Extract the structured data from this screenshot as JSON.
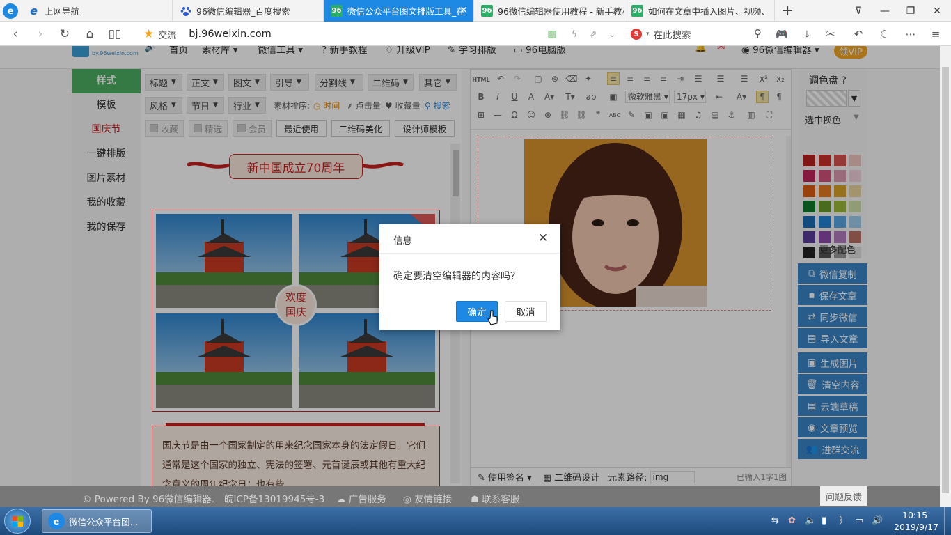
{
  "browser": {
    "tabs": [
      {
        "label": "上网导航",
        "icon": "ie-icon"
      },
      {
        "label": "96微信编辑器_百度搜索",
        "icon": "baidu-paw-icon"
      },
      {
        "label": "微信公众平台图文排版工具_在",
        "icon": "96-logo-icon",
        "active": true,
        "badge": "96"
      },
      {
        "label": "96微信编辑器使用教程 - 新手教程",
        "icon": "96-logo-icon",
        "badge": "96"
      },
      {
        "label": "如何在文章中插入图片、视频、",
        "icon": "96-logo-icon",
        "badge": "96"
      }
    ],
    "new_tab": "+",
    "address": {
      "favorite_label": "交流",
      "url": "bj.96weixin.com"
    },
    "search_placeholder": "在此搜索"
  },
  "site": {
    "logo_text": "by.96weixin.com",
    "nav": [
      "首页",
      "素材库",
      "微信工具",
      "新手教程",
      "升级VIP",
      "学习排版",
      "96电脑版"
    ],
    "user": "96微信编辑器",
    "vip_button": "领VIP"
  },
  "left_nav": {
    "header": "样式",
    "items": [
      "模板",
      "国庆节",
      "一键排版",
      "图片素材",
      "我的收藏",
      "我的保存"
    ],
    "active_index": 1
  },
  "filters": {
    "row1": [
      "标题",
      "正文",
      "图文",
      "引导",
      "分割线",
      "二维码",
      "其它"
    ],
    "row2": [
      "风格",
      "节日",
      "行业"
    ],
    "sort_label": "素材排序:",
    "sort_options": [
      "时间",
      "点击量",
      "收藏量"
    ],
    "search": "搜索",
    "checkboxes": [
      "收藏",
      "精选",
      "会员"
    ],
    "buttons": [
      "最近使用",
      "二维码美化",
      "设计师模板"
    ]
  },
  "material": {
    "banner_title": "新中国成立70周年",
    "badge_line1": "欢度",
    "badge_line2": "国庆",
    "paragraph": "国庆节是由一个国家制定的用来纪念国家本身的法定假日。它们通常是这个国家的独立、宪法的签署、元首诞辰或其他有重大纪念意义的周年纪念日；也有些"
  },
  "editor": {
    "toolbar": {
      "font": "微软雅黑",
      "size": "17px",
      "html_label": "HTML"
    },
    "bottom": {
      "sign": "使用签名",
      "qr": "二维码设计",
      "path_label": "元素路径:",
      "path_value": "img",
      "count": "已输入1字1图"
    }
  },
  "palette": {
    "title": "调色盘",
    "select_label": "选中换色",
    "more": "更多配色",
    "colors": [
      [
        "#b8221d",
        "#c9302c",
        "#d9534f",
        "#ecc6bf"
      ],
      [
        "#c0245c",
        "#d2527a",
        "#dc9ab0",
        "#f1d1dc"
      ],
      [
        "#dd5c11",
        "#e57c22",
        "#d9a227",
        "#e9d69c"
      ],
      [
        "#0f7a2a",
        "#679a2a",
        "#9cba3a",
        "#cfe0a8"
      ],
      [
        "#1c6cb7",
        "#2585d6",
        "#5aa8e5",
        "#9fcdef"
      ],
      [
        "#5a3b99",
        "#8d4aa8",
        "#b57bc0",
        "#b87062"
      ],
      [
        "#222222",
        "#555555",
        "#999999",
        "#dddddd"
      ]
    ]
  },
  "actions": {
    "group1": [
      {
        "label": "微信复制",
        "icon": "copy-icon"
      },
      {
        "label": "保存文章",
        "icon": "save-icon"
      },
      {
        "label": "同步微信",
        "icon": "sync-icon"
      },
      {
        "label": "导入文章",
        "icon": "import-icon"
      }
    ],
    "group2": [
      {
        "label": "生成图片",
        "icon": "image-icon"
      },
      {
        "label": "清空内容",
        "icon": "trash-icon"
      },
      {
        "label": "云端草稿",
        "icon": "cloud-icon"
      },
      {
        "label": "文章预览",
        "icon": "eye-icon"
      },
      {
        "label": "进群交流",
        "icon": "group-icon"
      }
    ]
  },
  "dialog": {
    "title": "信息",
    "message": "确定要清空编辑器的内容吗？",
    "confirm": "确定",
    "cancel": "取消"
  },
  "footer": {
    "powered": "© Powered By 96微信编辑器.",
    "icp": "皖ICP备13019945号-3",
    "links": [
      "广告服务",
      "友情链接",
      "联系客服"
    ],
    "feedback": "问题反馈"
  },
  "taskbar": {
    "window_title": "微信公众平台图...",
    "time": "10:15",
    "date": "2019/9/17"
  }
}
